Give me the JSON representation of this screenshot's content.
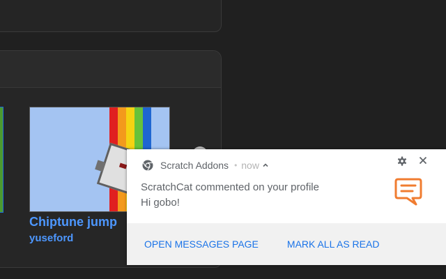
{
  "project_card": {
    "title": "Chiptune jump",
    "author": "yuseford"
  },
  "notification": {
    "app_name": "Scratch Addons",
    "time": "now",
    "title": "ScratchCat commented on your profile",
    "body": "Hi gobo!",
    "actions": [
      {
        "label": "Open messages page"
      },
      {
        "label": "Mark all as read"
      }
    ],
    "icons": {
      "app": "chrome-icon",
      "expand": "caret-up-icon",
      "settings": "gear-icon",
      "close": "close-icon",
      "message": "comment-bubble-icon"
    }
  },
  "colors": {
    "page_background": "#202020",
    "link_blue": "#4d97ff",
    "action_blue": "#1a73e8",
    "notification_accent": "#f07c30"
  }
}
